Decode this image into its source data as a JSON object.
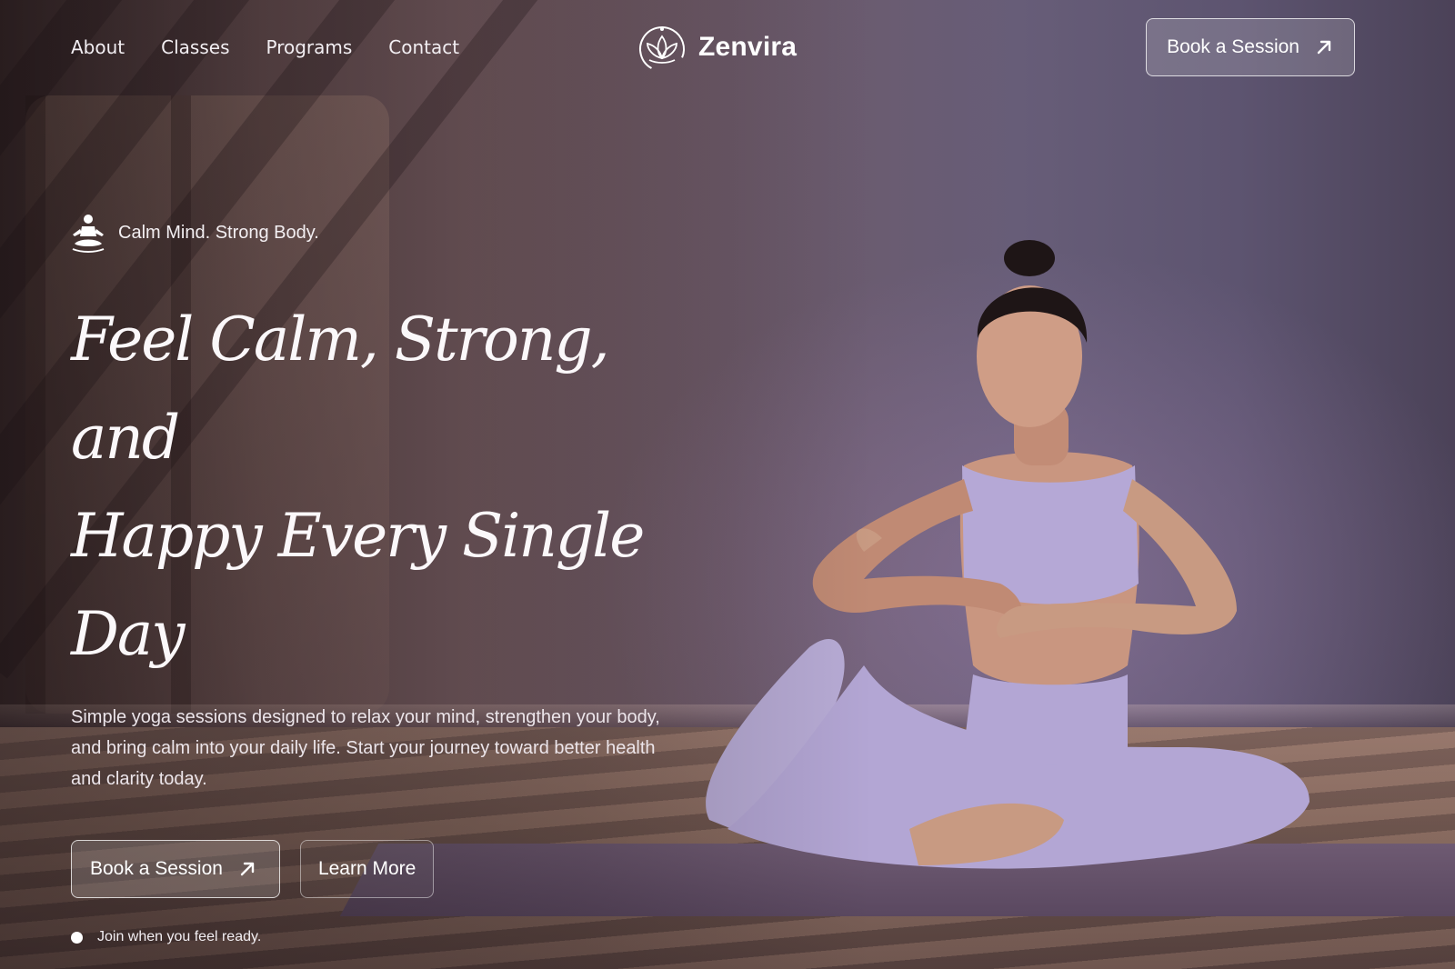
{
  "nav": {
    "links": [
      "About",
      "Classes",
      "Programs",
      "Contact"
    ],
    "brand": "Zenvira",
    "cta_label": "Book a Session"
  },
  "hero": {
    "tagline": "Calm Mind. Strong Body.",
    "headline_line1": "Feel Calm, Strong, and",
    "headline_line2": "Happy Every Single Day",
    "description": "Simple yoga sessions designed to relax your mind, strengthen your body, and bring calm into your daily life. Start your journey toward better health and clarity today.",
    "primary_cta": "Book a Session",
    "secondary_cta": "Learn More",
    "note": "Join when you feel ready."
  },
  "icons": {
    "logo": "lotus-icon",
    "tagline": "meditation-icon",
    "cta": "arrow-up-right-icon"
  },
  "colors": {
    "text": "#ffffff",
    "wall": "#675d78",
    "outfit": "#b3a6d4"
  }
}
